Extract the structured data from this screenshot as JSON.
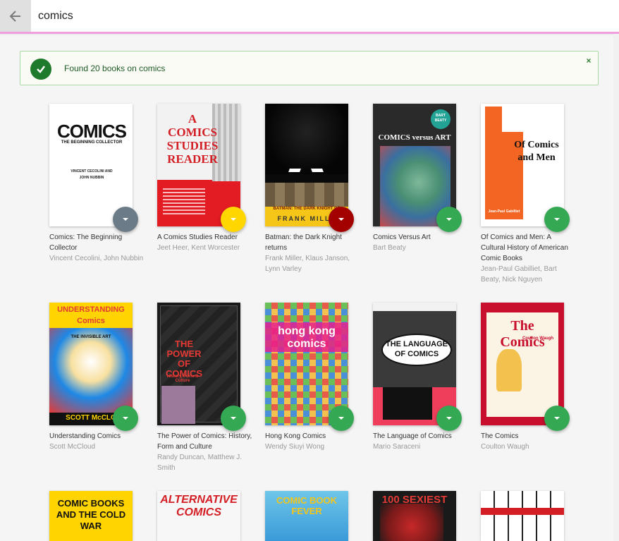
{
  "search": {
    "query": "comics"
  },
  "alert": {
    "message": "Found 20 books on comics",
    "close": "×"
  },
  "books": [
    {
      "title": "Comics: The Beginning Collector",
      "authors": "Vincent Cecolini, John Nubbin",
      "fab_color": "#6b7c88",
      "cover_text": "COMICS",
      "cover_sub": "THE BEGINNING COLLECTOR",
      "cover_small": "VINCENT CECOLINI AND JOHN NUBBIN"
    },
    {
      "title": "A Comics Studies Reader",
      "authors": "Jeet Heer, Kent Worcester",
      "fab_color": "#ffd600",
      "cover_text": "A COMICS STUDIES READER"
    },
    {
      "title": "Batman: the Dark Knight returns",
      "authors": "Frank Miller, Klaus Janson, Lynn Varley",
      "fab_color": "#a30000",
      "cover_text": "BATMAN: THE DARK KNIGHT RE",
      "cover_sub": "FRANK MILLE"
    },
    {
      "title": "Comics Versus Art",
      "authors": "Bart Beaty",
      "fab_color": "#35a853",
      "cover_text": "COMICS versus ART",
      "cover_badge": "BART BEATY"
    },
    {
      "title": "Of Comics and Men: A Cultural History of American Comic Books",
      "authors": "Jean-Paul Gabilliet, Bart Beaty, Nick Nguyen",
      "fab_color": "#35a853",
      "cover_text": "Of Comics and Men",
      "cover_small": "Jean-Paul Gabilliet"
    },
    {
      "title": "Understanding Comics",
      "authors": "Scott McCloud",
      "fab_color": "#35a853",
      "cover_text": "UNDERSTANDING Comics",
      "cover_sub": "THE INVISIBLE ART",
      "cover_small": "SCOTT McCLO"
    },
    {
      "title": "The Power of Comics: History, Form and Culture",
      "authors": "Randy Duncan, Matthew J. Smith",
      "fab_color": "#35a853",
      "cover_text": "THE POWER OF COMICS",
      "cover_sub": "History, Form & Culture"
    },
    {
      "title": "Hong Kong Comics",
      "authors": "Wendy Siuyi Wong",
      "fab_color": "#35a853",
      "cover_text": "hong kong comics"
    },
    {
      "title": "The Language of Comics",
      "authors": "Mario Saraceni",
      "fab_color": "#35a853",
      "cover_text": "THE LANGUAGE OF COMICS"
    },
    {
      "title": "The Comics",
      "authors": "Coulton Waugh",
      "fab_color": "#35a853",
      "cover_text": "The Comics",
      "cover_sub": "Coulton Waugh"
    },
    {
      "title": "",
      "authors": "",
      "fab_color": "",
      "cover_text": "COMIC BOOKS AND THE COLD WAR"
    },
    {
      "title": "",
      "authors": "",
      "fab_color": "",
      "cover_text": "ALTERNATIVE COMICS"
    },
    {
      "title": "",
      "authors": "",
      "fab_color": "",
      "cover_text": "COMIC BOOK FEVER"
    },
    {
      "title": "",
      "authors": "",
      "fab_color": "",
      "cover_text": "100 SEXIEST"
    },
    {
      "title": "",
      "authors": "",
      "fab_color": "",
      "cover_text": ""
    }
  ]
}
